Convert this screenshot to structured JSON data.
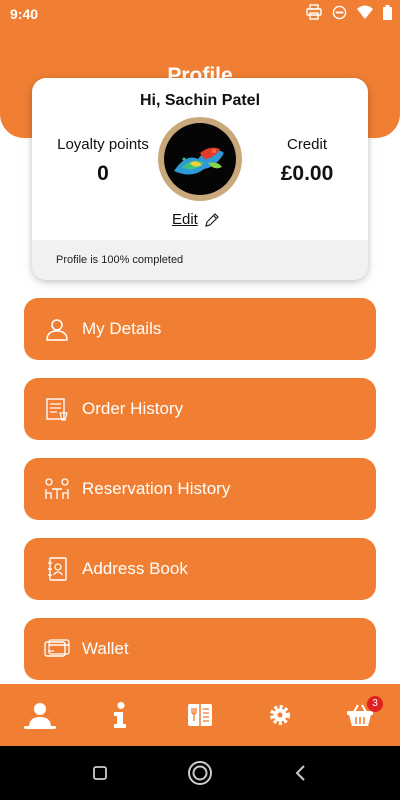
{
  "status_bar": {
    "time": "9:40"
  },
  "header": {
    "title": "Profile"
  },
  "profile": {
    "greeting": "Hi, Sachin Patel",
    "loyalty_label": "Loyalty points",
    "loyalty_value": "0",
    "credit_label": "Credit",
    "credit_value": "£0.00",
    "edit_label": "Edit",
    "completion_text": "Profile is 100% completed"
  },
  "menu": {
    "items": [
      {
        "label": "My Details",
        "icon": "person-icon"
      },
      {
        "label": "Order History",
        "icon": "receipt-icon"
      },
      {
        "label": "Reservation History",
        "icon": "dining-table-icon"
      },
      {
        "label": "Address Book",
        "icon": "address-book-icon"
      },
      {
        "label": "Wallet",
        "icon": "wallet-card-icon"
      }
    ]
  },
  "bottom_nav": {
    "items": [
      "profile-icon",
      "info-icon",
      "menu-book-icon",
      "settings-gear-icon",
      "basket-icon"
    ],
    "basket_count": "3"
  },
  "colors": {
    "brand": "#f07f33",
    "badge": "#e02020",
    "avatar_ring": "#c9a97c"
  }
}
